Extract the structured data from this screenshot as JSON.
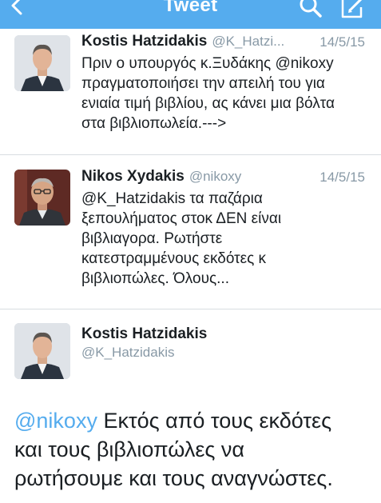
{
  "nav": {
    "title": "Tweet",
    "back_icon": "chevron-left-icon",
    "search_icon": "search-icon",
    "compose_icon": "compose-icon",
    "bar_color": "#55acee"
  },
  "tweets": [
    {
      "name": "Kostis Hatzidakis",
      "handle": "@K_Hatzi...",
      "date": "14/5/15",
      "lines": [
        "Πριν ο υπουργός κ.Ξυδάκης @nikoxy",
        "πραγματοποιήσει την απειλή του για",
        "ενιαία τιμή βιβλίου, ας κάνει μια βόλτα",
        "στα βιβλιοπωλεία.--->"
      ]
    },
    {
      "name": "Nikos Xydakis",
      "handle": "@nikoxy",
      "date": "14/5/15",
      "lines": [
        "@K_Hatzidakis τα παζάρια",
        "ξεπουλήματος στοκ ΔΕΝ είναι",
        "βιβλιαγορα. Ρωτήστε",
        "κατεστραμμένους εκδότες κ",
        "βιβλιοπώλες. Όλους..."
      ]
    }
  ],
  "main_tweet": {
    "name": "Kostis Hatzidakis",
    "handle": "@K_Hatzidakis",
    "mention": "@nikoxy",
    "line1_rest": " Εκτός από τους εκδότες",
    "line2": "και τους βιβλιοπώλες να",
    "line3": "ρωτήσουμε και τους αναγνώστες."
  }
}
